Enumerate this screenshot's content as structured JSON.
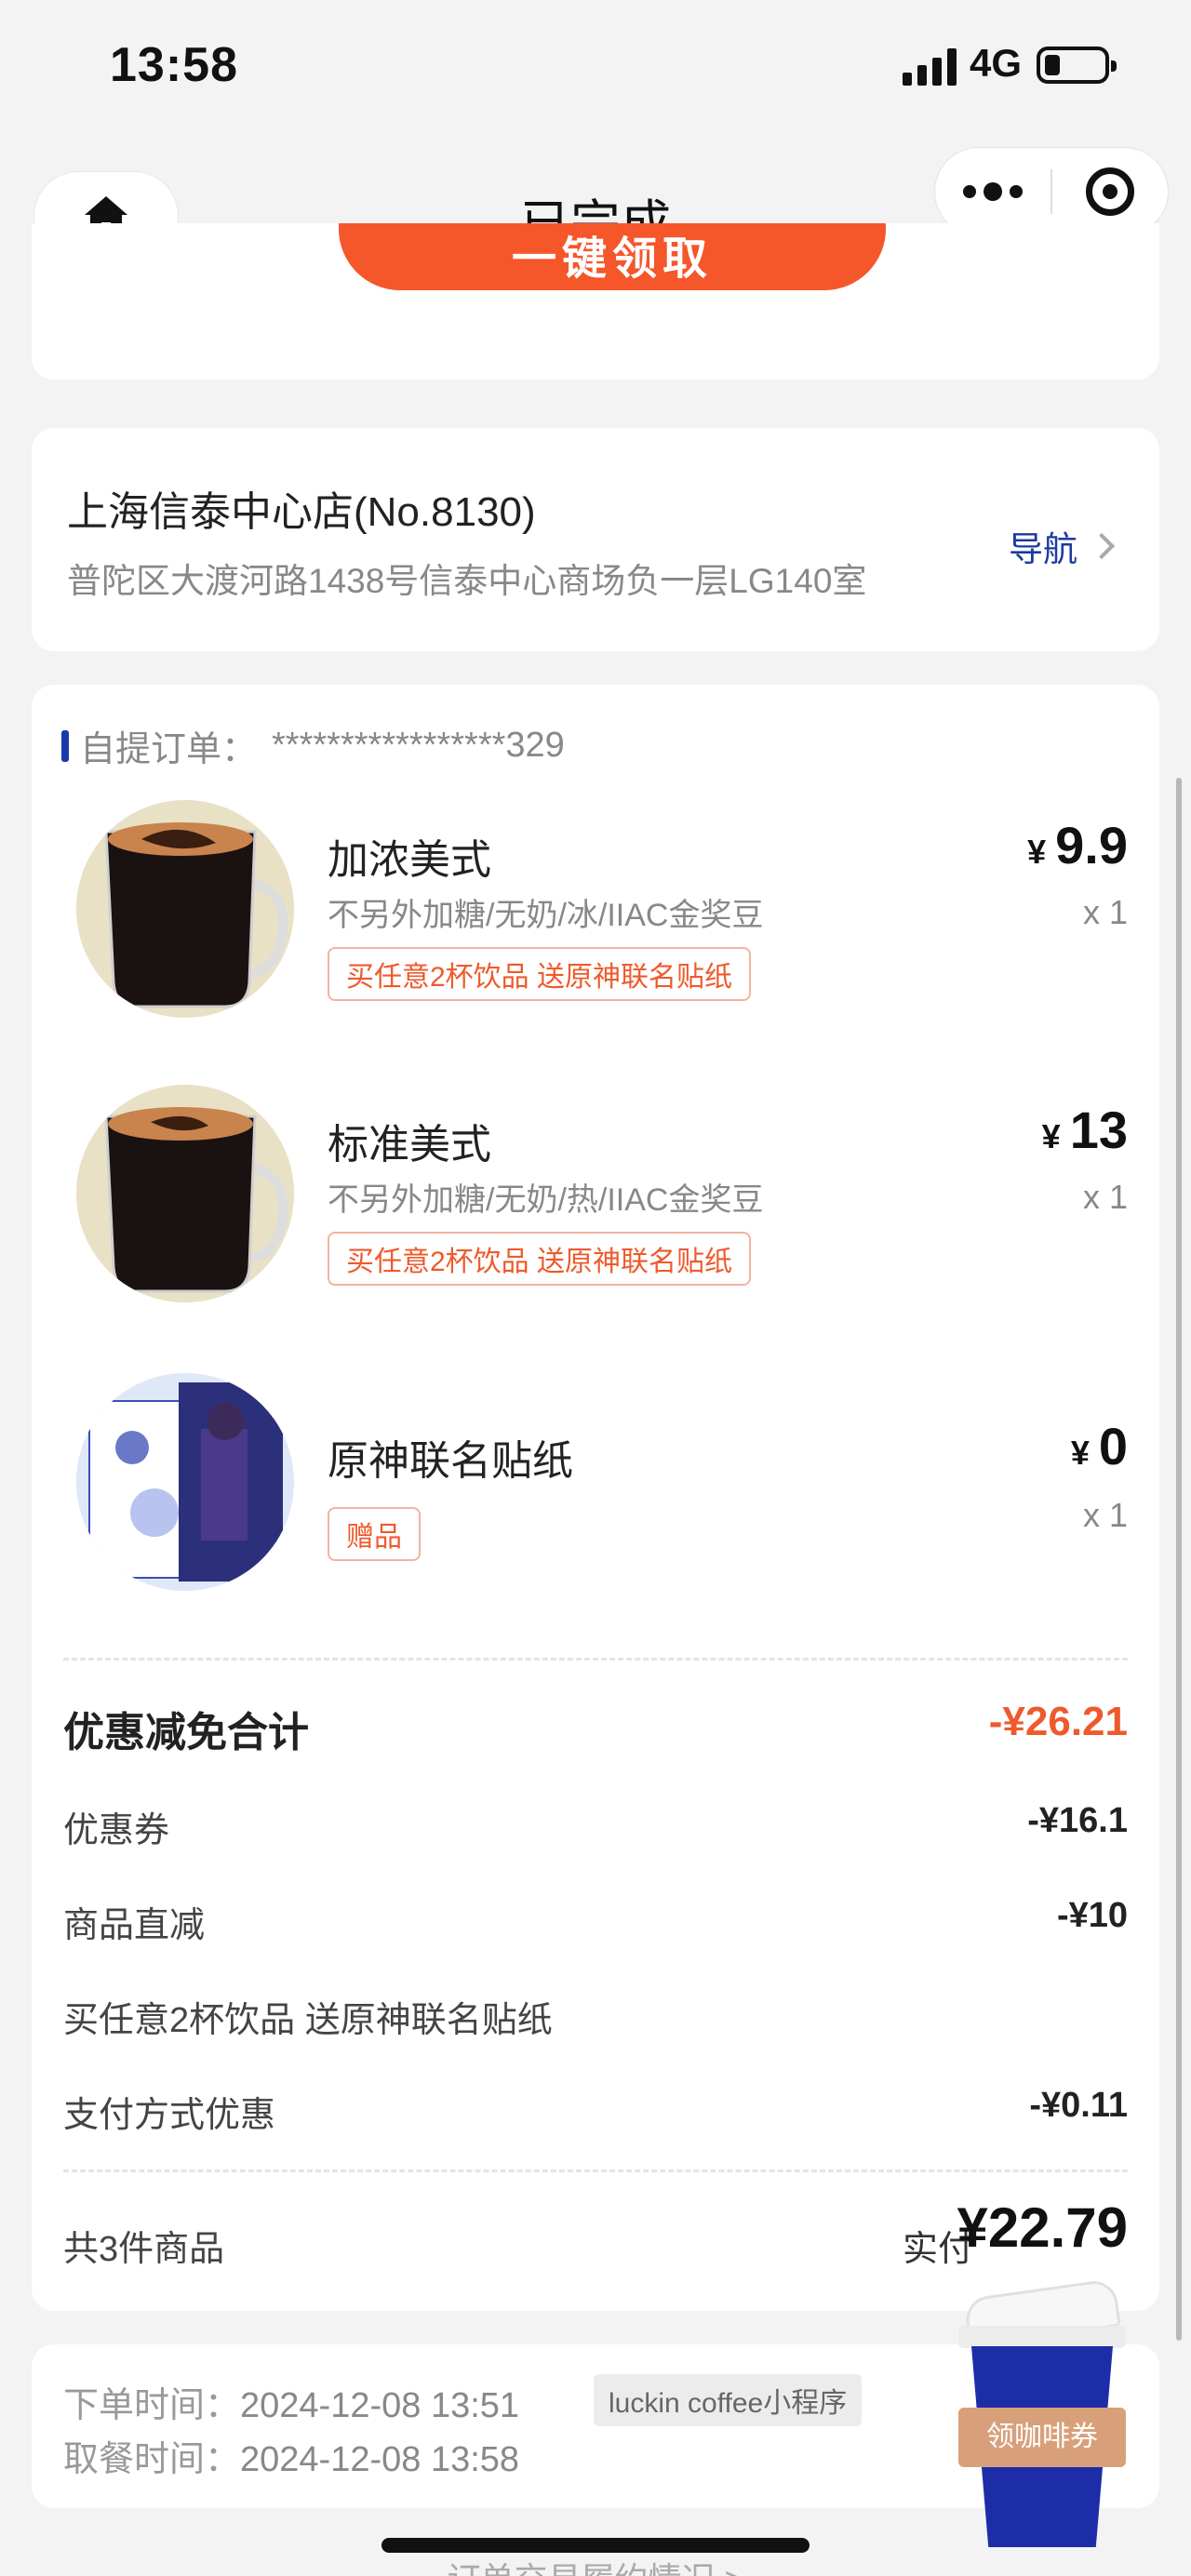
{
  "status_bar": {
    "time": "13:58",
    "network": "4G",
    "battery_level": 0.2
  },
  "nav": {
    "title": "已完成"
  },
  "claim": {
    "button_label": "一键领取"
  },
  "store": {
    "name": "上海信泰中心店(No.8130)",
    "address": "普陀区大渡河路1438号信泰中心商场负一层LG140室",
    "nav_label": "导航"
  },
  "order": {
    "label": "自提订单：",
    "number": "*****************329",
    "items": [
      {
        "name": "加浓美式",
        "spec": "不另外加糖/无奶/冰/IIAC金奖豆",
        "tag": "买任意2杯饮品 送原神联名贴纸",
        "currency": "¥",
        "price": "9.9",
        "qty": "x 1"
      },
      {
        "name": "标准美式",
        "spec": "不另外加糖/无奶/热/IIAC金奖豆",
        "tag": "买任意2杯饮品 送原神联名贴纸",
        "currency": "¥",
        "price": "13",
        "qty": "x 1"
      },
      {
        "name": "原神联名贴纸",
        "spec": "",
        "tag": "赠品",
        "currency": "¥",
        "price": "0",
        "qty": "x 1"
      }
    ],
    "discount": {
      "title": "优惠减免合计",
      "total": "-¥26.21",
      "rows": [
        {
          "label": "优惠券",
          "value": "-¥16.1"
        },
        {
          "label": "商品直减",
          "value": "-¥10"
        },
        {
          "label": "买任意2杯饮品 送原神联名贴纸",
          "value": ""
        },
        {
          "label": "支付方式优惠",
          "value": "-¥0.11"
        }
      ]
    },
    "count_label": "共3件商品",
    "paid_label": "实付",
    "paid_value": "¥22.79"
  },
  "times": {
    "order_label": "下单时间：",
    "order_time": "2024-12-08 13:51",
    "source": "luckin coffee小程序",
    "pickup_label": "取餐时间：",
    "pickup_time": "2024-12-08 13:58"
  },
  "float_cup": {
    "label": "领咖啡券"
  },
  "bottom_link": "订单交易履约情况 >",
  "colors": {
    "accent": "#f5562a",
    "brand_blue": "#1b39a8",
    "discount_red": "#ee5a2c"
  },
  "icons": [
    "home-icon",
    "more-icon",
    "target-icon",
    "chevron-right-icon",
    "battery-icon",
    "signal-icon"
  ]
}
